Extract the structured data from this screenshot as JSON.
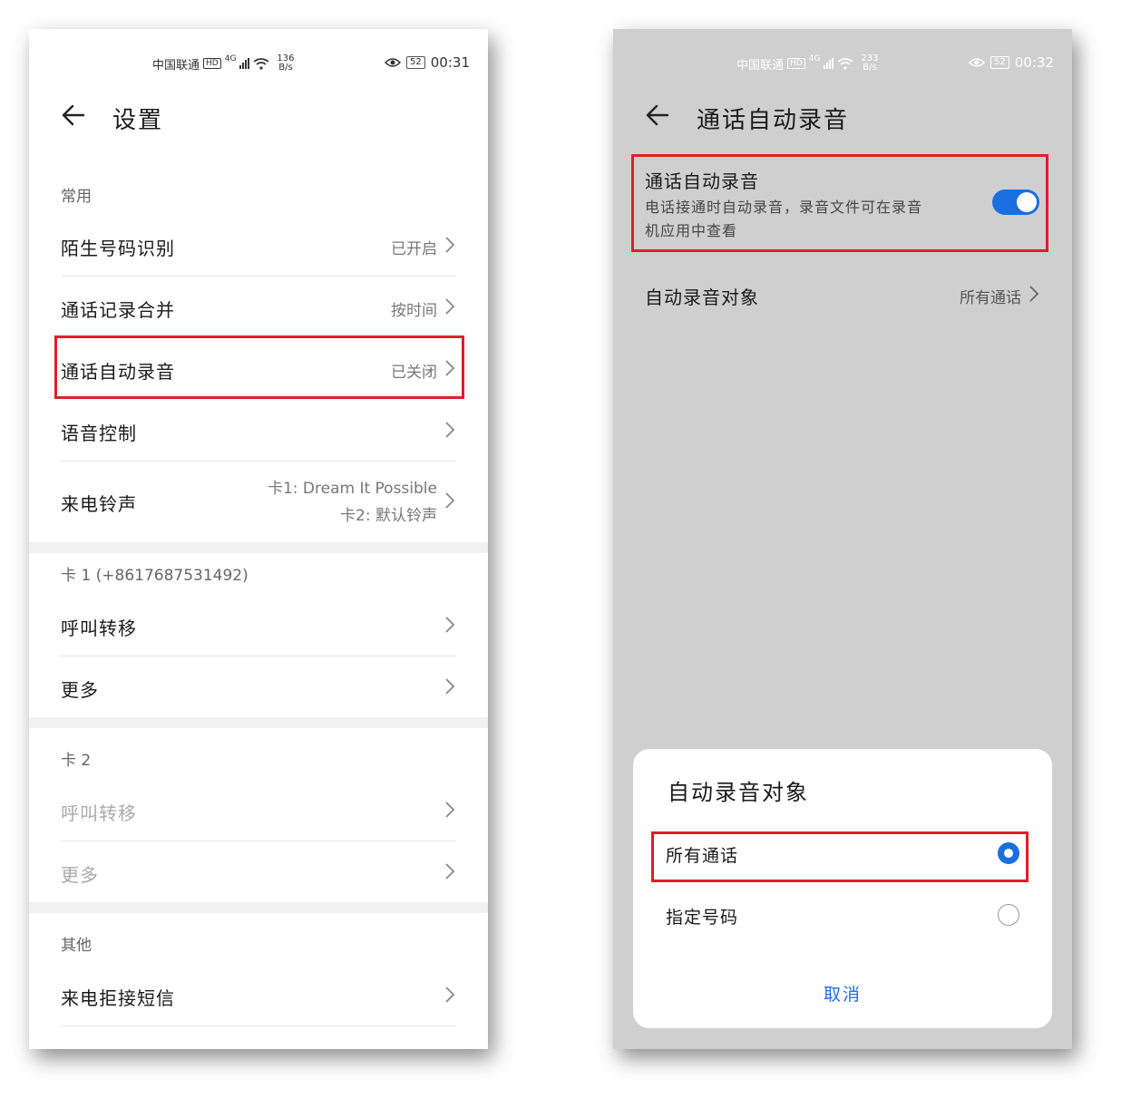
{
  "left": {
    "status": {
      "carrier": "中国联通",
      "hd": "HD",
      "network": "4G",
      "speed_num": "136",
      "speed_unit": "B/s",
      "battery": "52",
      "time": "00:31"
    },
    "title": "设置",
    "section_common": "常用",
    "items_common": [
      {
        "label": "陌生号码识别",
        "value": "已开启"
      },
      {
        "label": "通话记录合并",
        "value": "按时间"
      },
      {
        "label": "通话自动录音",
        "value": "已关闭"
      },
      {
        "label": "语音控制",
        "value": ""
      }
    ],
    "ringtone": {
      "label": "来电铃声",
      "line1": "卡1: Dream It Possible",
      "line2": "卡2: 默认铃声"
    },
    "section_card1": "卡 1 (+8617687531492)",
    "items_card1": [
      {
        "label": "呼叫转移"
      },
      {
        "label": "更多"
      }
    ],
    "section_card2": "卡 2",
    "items_card2": [
      {
        "label": "呼叫转移"
      },
      {
        "label": "更多"
      }
    ],
    "section_other": "其他",
    "items_other": [
      {
        "label": "来电拒接短信"
      }
    ]
  },
  "right": {
    "status": {
      "carrier": "中国联通",
      "hd": "HD",
      "network": "4G",
      "speed_num": "233",
      "speed_unit": "B/s",
      "battery": "52",
      "time": "00:32"
    },
    "title": "通话自动录音",
    "record": {
      "label": "通话自动录音",
      "desc_line1": "电话接通时自动录音，录音文件可在录音",
      "desc_line2": "机应用中查看",
      "enabled": true
    },
    "target": {
      "label": "自动录音对象",
      "value": "所有通话"
    },
    "sheet": {
      "title": "自动录音对象",
      "options": [
        {
          "label": "所有通话",
          "selected": true
        },
        {
          "label": "指定号码",
          "selected": false
        }
      ],
      "cancel": "取消"
    },
    "accent": "#1a6fe0"
  },
  "highlight_color": "#e01e2b"
}
